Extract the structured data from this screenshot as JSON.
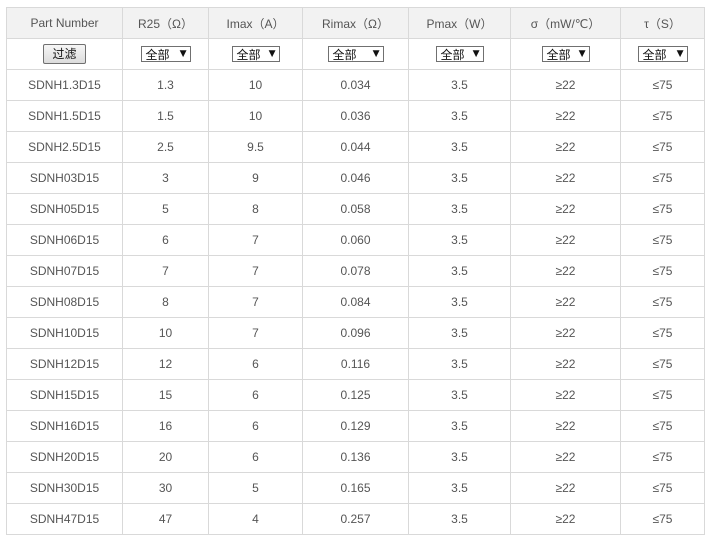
{
  "columns": [
    "Part Number",
    "R25（Ω）",
    "Imax（A）",
    "Rimax（Ω）",
    "Pmax（W）",
    "σ（mW/℃）",
    "τ（S）"
  ],
  "filter_button_label": "过滤",
  "filter_select_value": "全部",
  "dropdown_icon": "triangle-down",
  "rows": [
    [
      "SDNH1.3D15",
      "1.3",
      "10",
      "0.034",
      "3.5",
      "≥22",
      "≤75"
    ],
    [
      "SDNH1.5D15",
      "1.5",
      "10",
      "0.036",
      "3.5",
      "≥22",
      "≤75"
    ],
    [
      "SDNH2.5D15",
      "2.5",
      "9.5",
      "0.044",
      "3.5",
      "≥22",
      "≤75"
    ],
    [
      "SDNH03D15",
      "3",
      "9",
      "0.046",
      "3.5",
      "≥22",
      "≤75"
    ],
    [
      "SDNH05D15",
      "5",
      "8",
      "0.058",
      "3.5",
      "≥22",
      "≤75"
    ],
    [
      "SDNH06D15",
      "6",
      "7",
      "0.060",
      "3.5",
      "≥22",
      "≤75"
    ],
    [
      "SDNH07D15",
      "7",
      "7",
      "0.078",
      "3.5",
      "≥22",
      "≤75"
    ],
    [
      "SDNH08D15",
      "8",
      "7",
      "0.084",
      "3.5",
      "≥22",
      "≤75"
    ],
    [
      "SDNH10D15",
      "10",
      "7",
      "0.096",
      "3.5",
      "≥22",
      "≤75"
    ],
    [
      "SDNH12D15",
      "12",
      "6",
      "0.116",
      "3.5",
      "≥22",
      "≤75"
    ],
    [
      "SDNH15D15",
      "15",
      "6",
      "0.125",
      "3.5",
      "≥22",
      "≤75"
    ],
    [
      "SDNH16D15",
      "16",
      "6",
      "0.129",
      "3.5",
      "≥22",
      "≤75"
    ],
    [
      "SDNH20D15",
      "20",
      "6",
      "0.136",
      "3.5",
      "≥22",
      "≤75"
    ],
    [
      "SDNH30D15",
      "30",
      "5",
      "0.165",
      "3.5",
      "≥22",
      "≤75"
    ],
    [
      "SDNH47D15",
      "47",
      "4",
      "0.257",
      "3.5",
      "≥22",
      "≤75"
    ]
  ]
}
